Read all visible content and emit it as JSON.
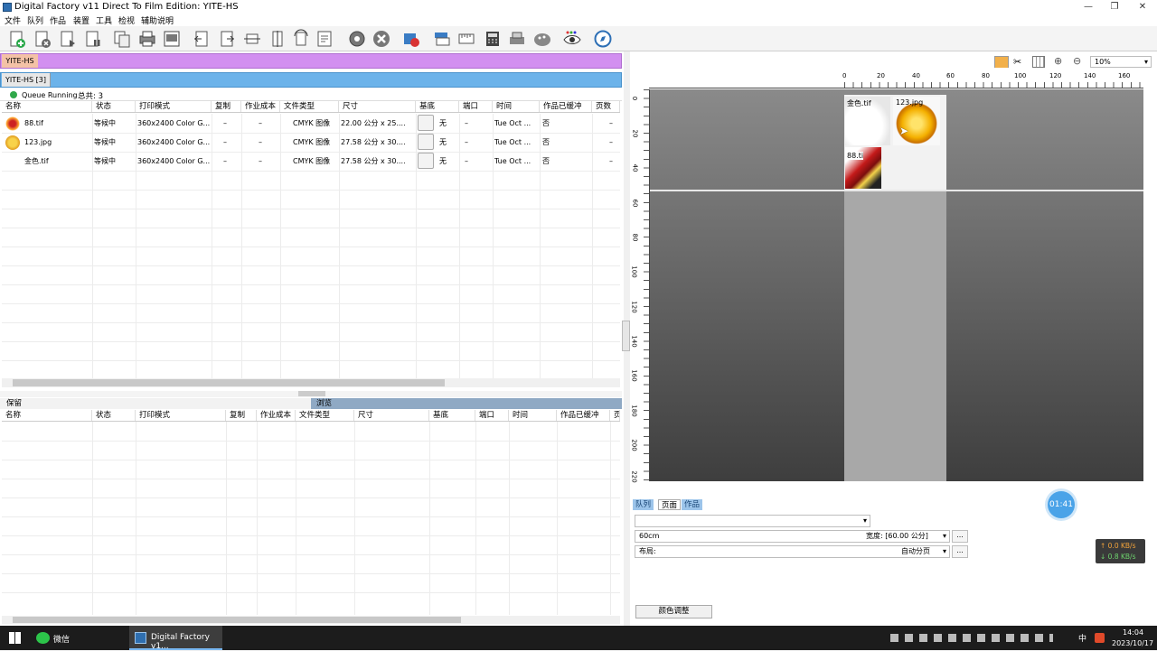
{
  "window": {
    "title": "Digital Factory v11 Direct To Film Edition: YITE-HS",
    "min": "—",
    "max": "❐",
    "close": "✕"
  },
  "menu": [
    "文件",
    "队列",
    "作品",
    "装置",
    "工具",
    "检视",
    "辅助说明"
  ],
  "queue_tab": {
    "primary": "YITE-HS",
    "secondary": "YITE-HS [3]"
  },
  "queue_status": {
    "running": "Queue Running",
    "total": "总共: 3"
  },
  "columns": [
    "名称",
    "状态",
    "打印模式",
    "复制",
    "作业成本",
    "文件类型",
    "尺寸",
    "基底",
    "端口",
    "时间",
    "作品已缓冲",
    "页数"
  ],
  "jobs": [
    {
      "name": "88.tif",
      "status": "等候中",
      "mode": "360x2400 Color G...",
      "copies": "–",
      "cost": "–",
      "type": "CMYK 图像",
      "size": "22.00 公分 x 25....",
      "base": "无",
      "port": "–",
      "time": "Tue Oct ...",
      "buffered": "否",
      "pages": "–"
    },
    {
      "name": "123.jpg",
      "status": "等候中",
      "mode": "360x2400 Color G...",
      "copies": "–",
      "cost": "–",
      "type": "CMYK 图像",
      "size": "27.58 公分 x 30....",
      "base": "无",
      "port": "–",
      "time": "Tue Oct ...",
      "buffered": "否",
      "pages": "–"
    },
    {
      "name": "金色.tif",
      "status": "等候中",
      "mode": "360x2400 Color G...",
      "copies": "–",
      "cost": "–",
      "type": "CMYK 图像",
      "size": "27.58 公分 x 30....",
      "base": "无",
      "port": "–",
      "time": "Tue Oct ...",
      "buffered": "否",
      "pages": "–"
    }
  ],
  "lower_tabs": {
    "hold": "保留",
    "browse": "浏览"
  },
  "lower_columns": [
    "名称",
    "状态",
    "打印模式",
    "复制",
    "作业成本",
    "文件类型",
    "尺寸",
    "基底",
    "端口",
    "时间",
    "作品已缓冲",
    "页数"
  ],
  "zoom": {
    "value": "10%",
    "arrow": "▾"
  },
  "ruler_x": [
    "0",
    "20",
    "40",
    "60",
    "80",
    "100",
    "120",
    "140",
    "160"
  ],
  "ruler_y": [
    "0",
    "20",
    "40",
    "60",
    "80",
    "100",
    "120",
    "140",
    "160",
    "180",
    "200",
    "220"
  ],
  "previews": {
    "gold": "金色.tif",
    "p123": "123.jpg",
    "p88": "88.ti"
  },
  "right_tabs": [
    "队列",
    "页面",
    "作品"
  ],
  "media": {
    "name": "60cm",
    "width_label": "宽度: [60.00 公分]",
    "layout_label": "布局:",
    "layout_value": "自动分页",
    "more": "..."
  },
  "color_adjust_button": "颜色调整",
  "timer": "01:41",
  "network": {
    "up": "↑ 0.0 KB/s",
    "down": "↓ 0.8 KB/s"
  },
  "taskbar": {
    "wechat": "微信",
    "app": "Digital Factory v1...",
    "time": "14:04",
    "date": "2023/10/17",
    "ime": "中"
  },
  "colors": {
    "queue_tab": "#d28ff0",
    "queue_tab2": "#6cb3ea",
    "running_dot": "#2fa84a"
  }
}
